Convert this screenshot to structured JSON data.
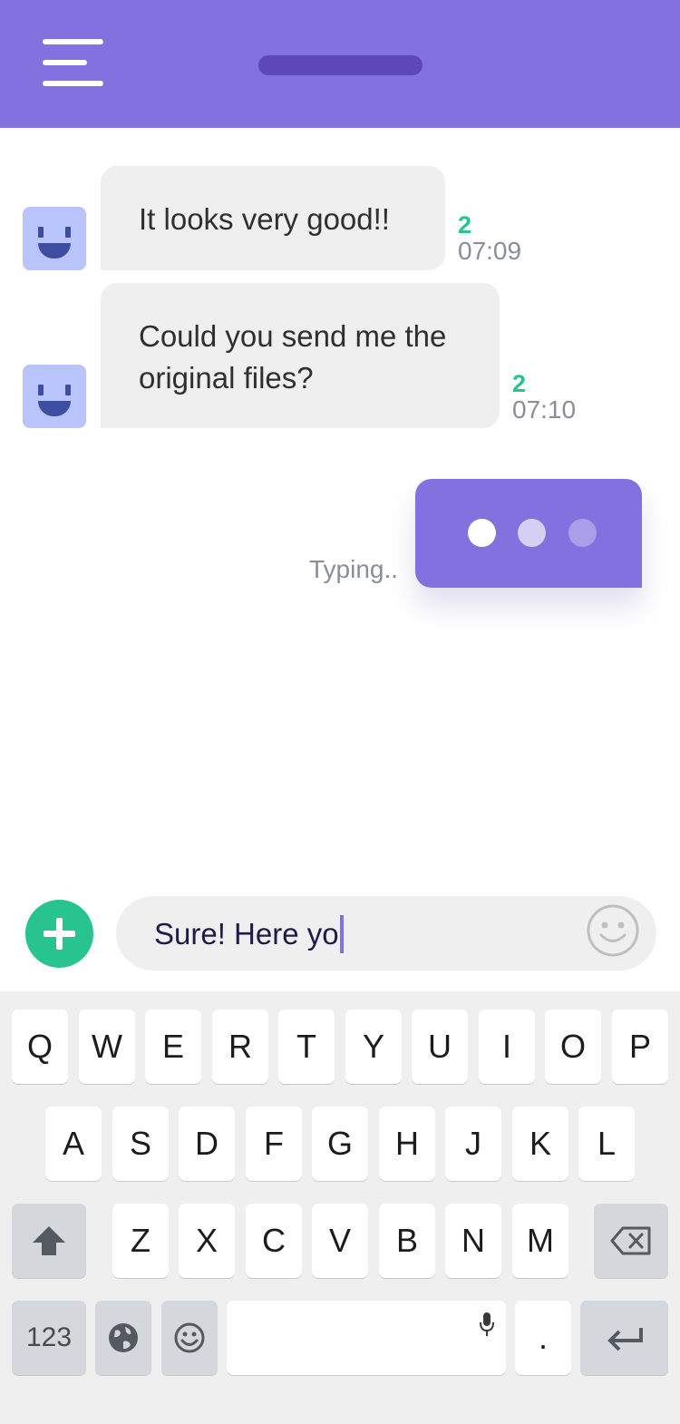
{
  "messages": [
    {
      "text_lines": [
        "It looks very good!!"
      ],
      "count": "2",
      "time": "07:09"
    },
    {
      "text_lines": [
        "Could you send me the",
        "original files?"
      ],
      "count": "2",
      "time": "07:10"
    }
  ],
  "typing": {
    "label": "Typing.."
  },
  "composer": {
    "input_value": "Sure! Here yo"
  },
  "keyboard": {
    "row1": [
      "Q",
      "W",
      "E",
      "R",
      "T",
      "Y",
      "U",
      "I",
      "O",
      "P"
    ],
    "row2": [
      "A",
      "S",
      "D",
      "F",
      "G",
      "H",
      "J",
      "K",
      "L"
    ],
    "row3": [
      "Z",
      "X",
      "C",
      "V",
      "B",
      "N",
      "M"
    ],
    "numbers_key": "123",
    "period_key": "."
  },
  "colors": {
    "brand_purple": "#8371df",
    "accent_green": "#27c48f",
    "bubble_gray": "#efefef",
    "avatar_blue": "#b9c4fc"
  },
  "icons": [
    "menu-icon",
    "smiley-avatar-icon",
    "plus-icon",
    "emoji-icon",
    "shift-icon",
    "backspace-icon",
    "globe-icon",
    "microphone-icon",
    "return-icon"
  ]
}
